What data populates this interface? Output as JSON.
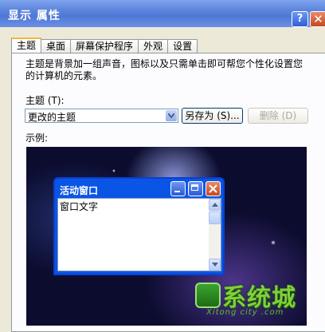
{
  "window": {
    "title": "显示 属性",
    "help_label": "?",
    "close_label": "✕"
  },
  "tabs": [
    {
      "label": "主题",
      "active": true
    },
    {
      "label": "桌面"
    },
    {
      "label": "屏幕保护程序"
    },
    {
      "label": "外观"
    },
    {
      "label": "设置"
    }
  ],
  "theme_page": {
    "description": "主题是背景加一组声音，图标以及只需单击即可帮您个性化设置您的计算机的元素。",
    "theme_label": "主题 (T):",
    "theme_value": "更改的主题",
    "save_as_label": "另存为 (S)...",
    "delete_label": "删除 (D)",
    "preview_label": "示例:"
  },
  "preview_window": {
    "title": "活动窗口",
    "body_text": "窗口文字"
  },
  "logo": {
    "text": "系统城",
    "subtitle": "Xitong city .com"
  },
  "colors": {
    "titlebar": "#5f86de",
    "dialog_bg": "#ece9d8",
    "active_tab_accent": "#f5b53c"
  }
}
